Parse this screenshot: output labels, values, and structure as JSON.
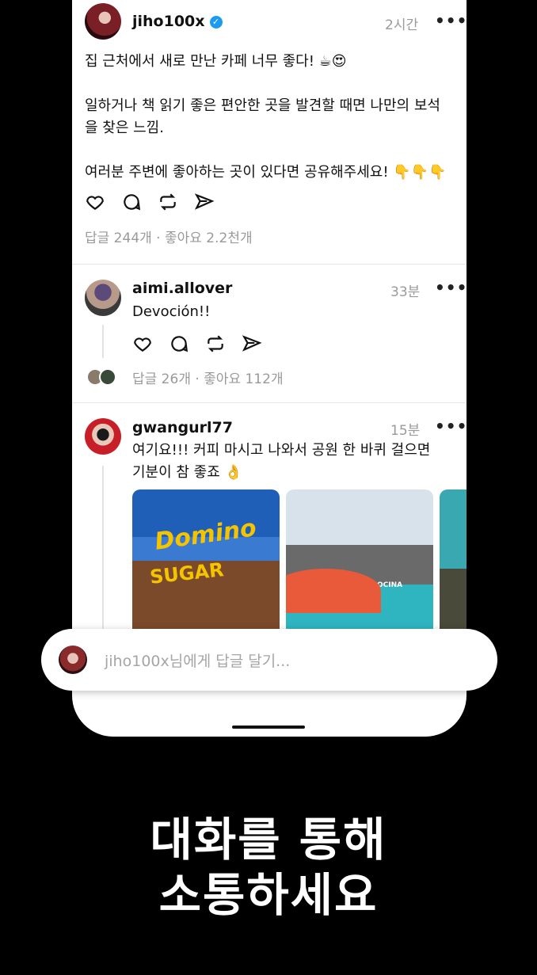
{
  "post": {
    "username": "jiho100x",
    "verified_icon": "verified-badge-icon",
    "time": "2시간",
    "more": "•••",
    "text": "집 근처에서 새로 만난 카페 너무 좋다! ☕😍\n\n일하거나 책 읽기 좋은 편안한 곳을 발견할 때면 나만의 보석을 찾은 느낌.\n\n여러분 주변에 좋아하는 곳이 있다면 공유해주세요! 👇👇👇",
    "stats": "답글 244개  ·  좋아요 2.2천개"
  },
  "reply1": {
    "username": "aimi.allover",
    "time": "33분",
    "more": "•••",
    "text": "Devoción!!",
    "stats": "답글 26개  ·  좋아요 112개"
  },
  "reply2": {
    "username": "gwangurl77",
    "time": "15분",
    "more": "•••",
    "text": "여기요!!! 커피 마시고 나와서 공원 한 바퀴 걸으면 기분이 참 좋죠 👌",
    "images": [
      {
        "text_line1": "Domino",
        "text_line2": "SUGAR"
      },
      {
        "text_line1": "TACOCINA"
      }
    ]
  },
  "composer": {
    "placeholder": "jiho100x님에게 답글 달기..."
  },
  "headline": {
    "line1": "대화를 통해",
    "line2": "소통하세요"
  },
  "icons": [
    "heart-icon",
    "comment-icon",
    "repost-icon",
    "share-icon"
  ],
  "colors": {
    "verified": "#1d9bf0",
    "background": "#000000",
    "card": "#ffffff"
  }
}
